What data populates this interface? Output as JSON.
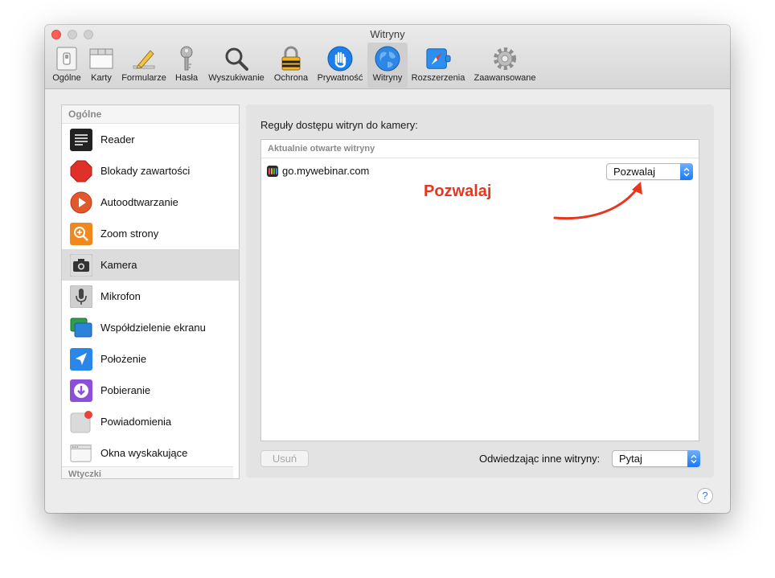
{
  "window": {
    "title": "Witryny"
  },
  "toolbar": {
    "items": [
      {
        "label": "Ogólne",
        "icon": "general-switch-icon"
      },
      {
        "label": "Karty",
        "icon": "tabs-icon"
      },
      {
        "label": "Formularze",
        "icon": "pencil-icon"
      },
      {
        "label": "Hasła",
        "icon": "key-icon"
      },
      {
        "label": "Wyszukiwanie",
        "icon": "magnifier-icon"
      },
      {
        "label": "Ochrona",
        "icon": "padlock-icon"
      },
      {
        "label": "Prywatność",
        "icon": "hand-icon"
      },
      {
        "label": "Witryny",
        "icon": "globe-icon",
        "selected": true
      },
      {
        "label": "Rozszerzenia",
        "icon": "puzzle-compass-icon"
      },
      {
        "label": "Zaawansowane",
        "icon": "gear-icon"
      }
    ]
  },
  "sidebar": {
    "header": "Ogólne",
    "items": [
      {
        "label": "Reader",
        "icon": "reader-icon"
      },
      {
        "label": "Blokady zawartości",
        "icon": "stop-octagon-icon"
      },
      {
        "label": "Autoodtwarzanie",
        "icon": "play-icon"
      },
      {
        "label": "Zoom strony",
        "icon": "zoom-icon"
      },
      {
        "label": "Kamera",
        "icon": "camera-icon",
        "selected": true
      },
      {
        "label": "Mikrofon",
        "icon": "microphone-icon"
      },
      {
        "label": "Współdzielenie ekranu",
        "icon": "screen-sharing-icon"
      },
      {
        "label": "Położenie",
        "icon": "location-arrow-icon"
      },
      {
        "label": "Pobieranie",
        "icon": "download-icon"
      },
      {
        "label": "Powiadomienia",
        "icon": "notification-icon"
      },
      {
        "label": "Okna wyskakujące",
        "icon": "popup-window-icon"
      }
    ],
    "footer": "Wtyczki"
  },
  "panel": {
    "title": "Reguły dostępu witryn do kamery:",
    "table_header": "Aktualnie otwarte witryny",
    "sites": [
      {
        "name": "go.mywebinar.com",
        "setting": "Pozwalaj"
      }
    ],
    "remove_button": "Usuń",
    "other_sites_label": "Odwiedzając inne witryny:",
    "other_sites_value": "Pytaj"
  },
  "annotation": {
    "text": "Pozwalaj",
    "color": "#e8361e"
  },
  "help": {
    "label": "?"
  },
  "colors": {
    "accent": "#1b79f2",
    "selection": "#dcdcdc"
  }
}
